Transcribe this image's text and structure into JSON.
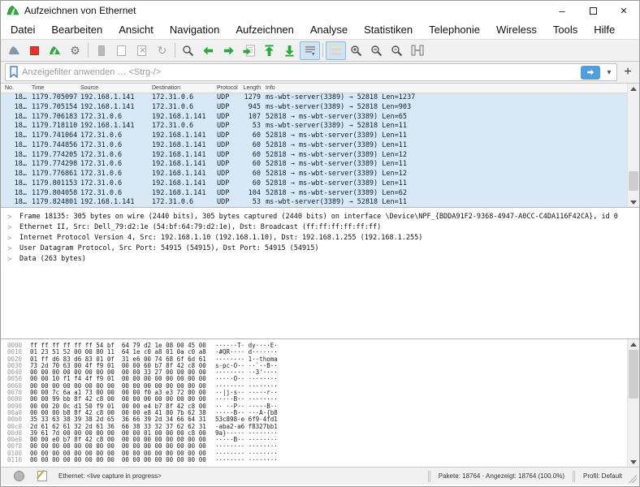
{
  "window": {
    "title": "Aufzeichnen von Ethernet"
  },
  "menu": {
    "items": [
      "Datei",
      "Bearbeiten",
      "Ansicht",
      "Navigation",
      "Aufzeichnen",
      "Analyse",
      "Statistiken",
      "Telephonie",
      "Wireless",
      "Tools",
      "Hilfe"
    ]
  },
  "toolbar": {
    "icons": [
      "wireshark-fin-start",
      "stop-capture",
      "restart-capture",
      "capture-options-gear",
      "open-file",
      "save-file",
      "close-file",
      "reload",
      "find-packet",
      "go-previous",
      "go-next",
      "go-to-packet",
      "go-first",
      "go-last",
      "auto-scroll",
      "colorize-packets",
      "zoom-in",
      "zoom-out",
      "zoom-original",
      "resize-columns"
    ]
  },
  "filter": {
    "placeholder": "Anzeigefilter anwenden … <Strg-/>",
    "add_label": "+"
  },
  "packet_list": {
    "columns": [
      "No.",
      "Time",
      "Source",
      "Destination",
      "Protocol",
      "Length",
      "Info"
    ],
    "rows": [
      {
        "no": "18…",
        "time": "1179.705097",
        "source": "192.168.1.141",
        "destination": "172.31.0.6",
        "protocol": "UDP",
        "length": "1279",
        "info": "ms-wbt-server(3389) → 52818 Len=1237"
      },
      {
        "no": "18…",
        "time": "1179.705154",
        "source": "192.168.1.141",
        "destination": "172.31.0.6",
        "protocol": "UDP",
        "length": "945",
        "info": "ms-wbt-server(3389) → 52818 Len=903"
      },
      {
        "no": "18…",
        "time": "1179.706183",
        "source": "172.31.0.6",
        "destination": "192.168.1.141",
        "protocol": "UDP",
        "length": "107",
        "info": "52818 → ms-wbt-server(3389) Len=65"
      },
      {
        "no": "18…",
        "time": "1179.718110",
        "source": "192.168.1.141",
        "destination": "172.31.0.6",
        "protocol": "UDP",
        "length": "53",
        "info": "ms-wbt-server(3389) → 52818 Len=11"
      },
      {
        "no": "18…",
        "time": "1179.741064",
        "source": "172.31.0.6",
        "destination": "192.168.1.141",
        "protocol": "UDP",
        "length": "60",
        "info": "52818 → ms-wbt-server(3389) Len=11"
      },
      {
        "no": "18…",
        "time": "1179.744856",
        "source": "172.31.0.6",
        "destination": "192.168.1.141",
        "protocol": "UDP",
        "length": "60",
        "info": "52818 → ms-wbt-server(3389) Len=11"
      },
      {
        "no": "18…",
        "time": "1179.774205",
        "source": "172.31.0.6",
        "destination": "192.168.1.141",
        "protocol": "UDP",
        "length": "60",
        "info": "52818 → ms-wbt-server(3389) Len=12"
      },
      {
        "no": "18…",
        "time": "1179.774298",
        "source": "172.31.0.6",
        "destination": "192.168.1.141",
        "protocol": "UDP",
        "length": "60",
        "info": "52818 → ms-wbt-server(3389) Len=11"
      },
      {
        "no": "18…",
        "time": "1179.776861",
        "source": "172.31.0.6",
        "destination": "192.168.1.141",
        "protocol": "UDP",
        "length": "60",
        "info": "52818 → ms-wbt-server(3389) Len=12"
      },
      {
        "no": "18…",
        "time": "1179.801153",
        "source": "172.31.0.6",
        "destination": "192.168.1.141",
        "protocol": "UDP",
        "length": "60",
        "info": "52818 → ms-wbt-server(3389) Len=11"
      },
      {
        "no": "18…",
        "time": "1179.804058",
        "source": "172.31.0.6",
        "destination": "192.168.1.141",
        "protocol": "UDP",
        "length": "104",
        "info": "52818 → ms-wbt-server(3389) Len=62"
      },
      {
        "no": "18…",
        "time": "1179.824801",
        "source": "192.168.1.141",
        "destination": "172.31.0.6",
        "protocol": "UDP",
        "length": "53",
        "info": "ms-wbt-server(3389) → 52818 Len=11"
      }
    ]
  },
  "details": {
    "rows": [
      "Frame 18135: 305 bytes on wire (2440 bits), 305 bytes captured (2440 bits) on interface \\Device\\NPF_{BDDA91F2-9368-4947-A0CC-C4DA116F42CA}, id 0",
      "Ethernet II, Src: Dell_79:d2:1e (54:bf:64:79:d2:1e), Dst: Broadcast (ff:ff:ff:ff:ff:ff)",
      "Internet Protocol Version 4, Src: 192.168.1.10 (192.168.1.10), Dst: 192.168.1.255 (192.168.1.255)",
      "User Datagram Protocol, Src Port: 54915 (54915), Dst Port: 54915 (54915)",
      "Data (263 bytes)"
    ]
  },
  "hex_dump": {
    "lines": [
      {
        "offset": "0000",
        "hex": "ff ff ff ff ff ff 54 bf  64 79 d2 1e 08 00 45 00",
        "ascii": "······T· dy····E·"
      },
      {
        "offset": "0010",
        "hex": "01 23 51 52 00 00 80 11  64 1e c0 a8 01 0a c0 a8",
        "ascii": "·#QR···· d·······"
      },
      {
        "offset": "0020",
        "hex": "01 ff d6 83 d6 83 01 0f  31 e6 00 74 68 6f 6d 61",
        "ascii": "········ 1··thoma"
      },
      {
        "offset": "0030",
        "hex": "73 2d 70 63 00 4f f9 01  00 00 60 b7 8f 42 c8 00",
        "ascii": "s-pc·O·· ··`··B··"
      },
      {
        "offset": "0040",
        "hex": "00 00 00 00 00 00 00 00  00 00 33 27 00 00 00 00",
        "ascii": "········ ··3'····"
      },
      {
        "offset": "0050",
        "hex": "00 00 10 f1 f4 4f f9 01  00 00 00 00 00 00 00 00",
        "ascii": "·····O·· ········"
      },
      {
        "offset": "0060",
        "hex": "00 00 00 00 00 00 00 00  00 00 00 00 00 00 00 00",
        "ascii": "········ ········"
      },
      {
        "offset": "0070",
        "hex": "00 00 7c 6a a1 73 00 00  00 00 f0 a3 e3 72 00 00",
        "ascii": "··|j·s·· ·····r··"
      },
      {
        "offset": "0080",
        "hex": "00 00 99 bb 8f 42 c8 00  00 00 00 00 00 00 00 00",
        "ascii": "·····B·· ········"
      },
      {
        "offset": "0090",
        "hex": "00 00 20 0c d1 50 f9 01  00 00 e4 b7 8f 42 c8 00",
        "ascii": "·· ··P·· ·····B··"
      },
      {
        "offset": "00a0",
        "hex": "00 00 00 b8 8f 42 c8 00  00 00 e8 41 80 7b 62 38",
        "ascii": "·····B·· ···A·{b8"
      },
      {
        "offset": "00b0",
        "hex": "35 33 63 38 39 38 2d 65  36 66 39 2d 34 66 64 31",
        "ascii": "53c898-e 6f9-4fd1"
      },
      {
        "offset": "00c0",
        "hex": "2d 61 62 61 32 2d 61 36  66 38 33 32 37 62 62 31",
        "ascii": "-aba2-a6 f8327bb1"
      },
      {
        "offset": "00d0",
        "hex": "39 61 7d 00 00 00 00 00  00 00 01 00 00 00 c8 00",
        "ascii": "9a}····· ········"
      },
      {
        "offset": "00e0",
        "hex": "00 00 e0 b7 8f 42 c8 00  00 00 00 00 00 00 00 00",
        "ascii": "·····B·· ········"
      },
      {
        "offset": "00f0",
        "hex": "00 00 00 00 00 00 00 00  00 00 00 00 00 00 00 00",
        "ascii": "········ ········"
      },
      {
        "offset": "0100",
        "hex": "00 00 00 00 00 00 00 00  00 00 00 00 00 00 00 00",
        "ascii": "········ ········"
      },
      {
        "offset": "0110",
        "hex": "00 00 00 00 00 00 00 00  00 00 00 00 00 00 00 00",
        "ascii": "········ ········"
      }
    ]
  },
  "status": {
    "capture": "Ethernet: <live capture in progress>",
    "packets": "Pakete: 18764 · Angezeigt: 18764 (100.0%)",
    "profile": "Profil: Default"
  },
  "colors": {
    "udp_row": "#d8e9f5",
    "accent_green": "#27a93c",
    "stop_red": "#e8322e",
    "apply_blue": "#4d9fe0",
    "active_button_bg": "#cfe3f5"
  }
}
